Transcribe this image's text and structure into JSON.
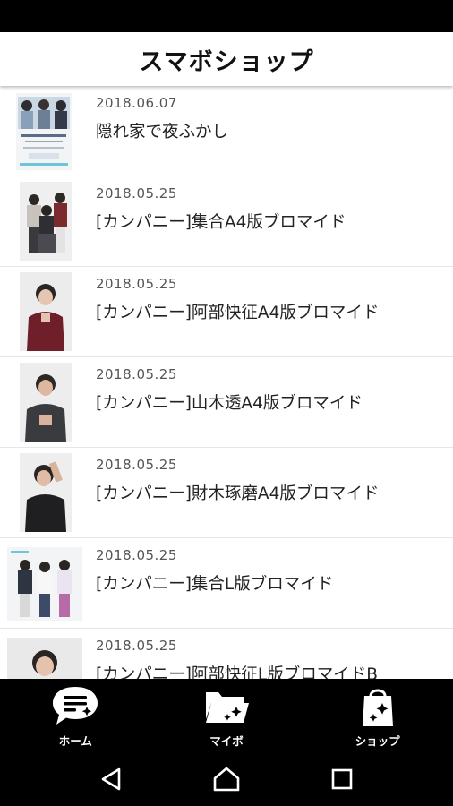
{
  "header": {
    "title": "スマボショップ"
  },
  "items": [
    {
      "date": "2018.06.07",
      "title": "隠れ家で夜ふかし"
    },
    {
      "date": "2018.05.25",
      "title": "[カンパニー]集合A4版ブロマイド"
    },
    {
      "date": "2018.05.25",
      "title": "[カンパニー]阿部快征A4版ブロマイド"
    },
    {
      "date": "2018.05.25",
      "title": "[カンパニー]山木透A4版ブロマイド"
    },
    {
      "date": "2018.05.25",
      "title": "[カンパニー]財木琢磨A4版ブロマイド"
    },
    {
      "date": "2018.05.25",
      "title": "[カンパニー]集合L版ブロマイド"
    },
    {
      "date": "2018.05.25",
      "title": "[カンパニー]阿部快征L版ブロマイドB"
    }
  ],
  "tabs": [
    {
      "label": "ホーム",
      "icon": "chat-bubble-icon"
    },
    {
      "label": "マイボ",
      "icon": "folder-sparkle-icon"
    },
    {
      "label": "ショップ",
      "icon": "shopping-bag-icon"
    }
  ],
  "nav": {
    "back": "back-icon",
    "home": "home-icon",
    "recents": "recents-icon"
  }
}
